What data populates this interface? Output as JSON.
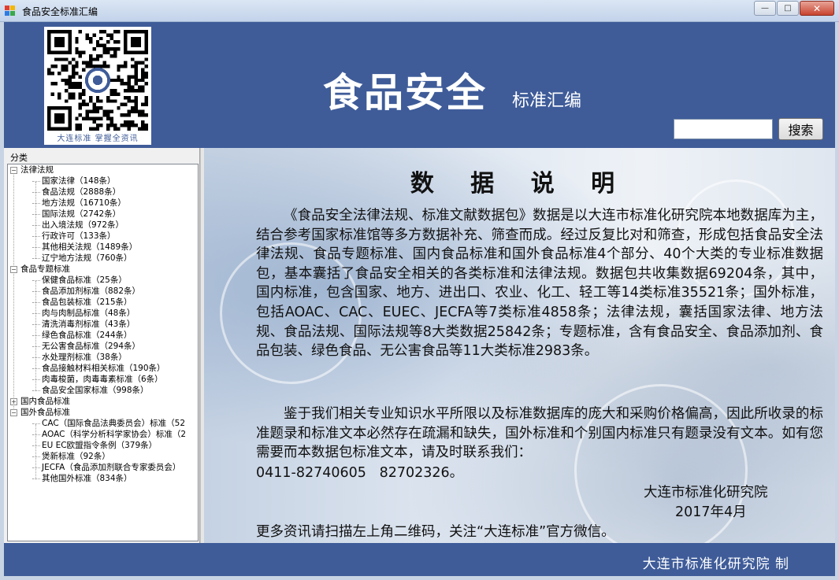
{
  "window": {
    "title": "食品安全标准汇编",
    "minimize_glyph": "—",
    "maximize_glyph": "□",
    "close_glyph": "✕"
  },
  "header": {
    "qr_caption": "大连标准  掌握全资讯",
    "main_title": "食品安全",
    "sub_title": "标准汇编",
    "search_value": "",
    "search_button": "搜索"
  },
  "sidebar": {
    "title": "分类",
    "groups": [
      {
        "label": "法律法规",
        "expanded": true,
        "toggle": "−",
        "items": [
          "国家法律（148条）",
          "食品法规（2888条）",
          "地方法规（16710条）",
          "国际法规（2742条）",
          "出入境法规（972条）",
          "行政许可（133条）",
          "其他相关法规（1489条）",
          "辽宁地方法规（760条）"
        ]
      },
      {
        "label": "食品专题标准",
        "expanded": true,
        "toggle": "−",
        "items": [
          "保健食品标准（25条）",
          "食品添加剂标准（882条）",
          "食品包装标准（215条）",
          "肉与肉制品标准（48条）",
          "清洗消毒剂标准（43条）",
          "绿色食品标准（244条）",
          "无公害食品标准（294条）",
          "水处理剂标准（38条）",
          "食品接触材料相关标准（190条）",
          "肉毒梭菌，肉毒毒素标准（6条）",
          "食品安全国家标准（998条）"
        ]
      },
      {
        "label": "国内食品标准",
        "expanded": false,
        "toggle": "+",
        "items": []
      },
      {
        "label": "国外食品标准",
        "expanded": true,
        "toggle": "−",
        "items": [
          "CAC（国际食品法典委员会）标准（52",
          "AOAC（科学分析科学家协会）标准（2",
          "EU EC欧盟指令条例（379条）",
          "煲新标准（92条）",
          "JECFA（食品添加剂联合专家委员会）",
          "其他国外标准（834条）"
        ]
      }
    ]
  },
  "content": {
    "title": "数 据 说 明",
    "paragraph1": "《食品安全法律法规、标准文献数据包》数据是以大连市标准化研究院本地数据库为主，结合参考国家标准馆等多方数据补充、筛查而成。经过反复比对和筛查，形成包括食品安全法律法规、食品专题标准、国内食品标准和国外食品标准4个部分、40个大类的专业标准数据包，基本囊括了食品安全相关的各类标准和法律法规。数据包共收集数据69204条，其中，国内标准，包含国家、地方、进出口、农业、化工、轻工等14类标准35521条；国外标准，包括AOAC、CAC、EUEC、JECFA等7类标准4858条；法律法规，囊括国家法律、地方法规、食品法规、国际法规等8大类数据25842条；专题标准，含有食品安全、食品添加剂、食品包装、绿色食品、无公害食品等11大类标准2983条。",
    "paragraph2": "鉴于我们相关专业知识水平所限以及标准数据库的庞大和采购价格偏高，因此所收录的标准题录和标准文本必然存在疏漏和缺失，国外标准和个别国内标准只有题录没有文本。如有您需要而本数据包标准文本，请及时联系我们：",
    "contact": "0411-82740605   82702326。",
    "signature_org": "大连市标准化研究院",
    "signature_date": "2017年4月",
    "more_info": "更多资讯请扫描左上角二维码，关注“大连标准”官方微信。"
  },
  "footer": {
    "text": "大连市标准化研究院  制"
  },
  "colors": {
    "brand_blue": "#3f5c99"
  }
}
